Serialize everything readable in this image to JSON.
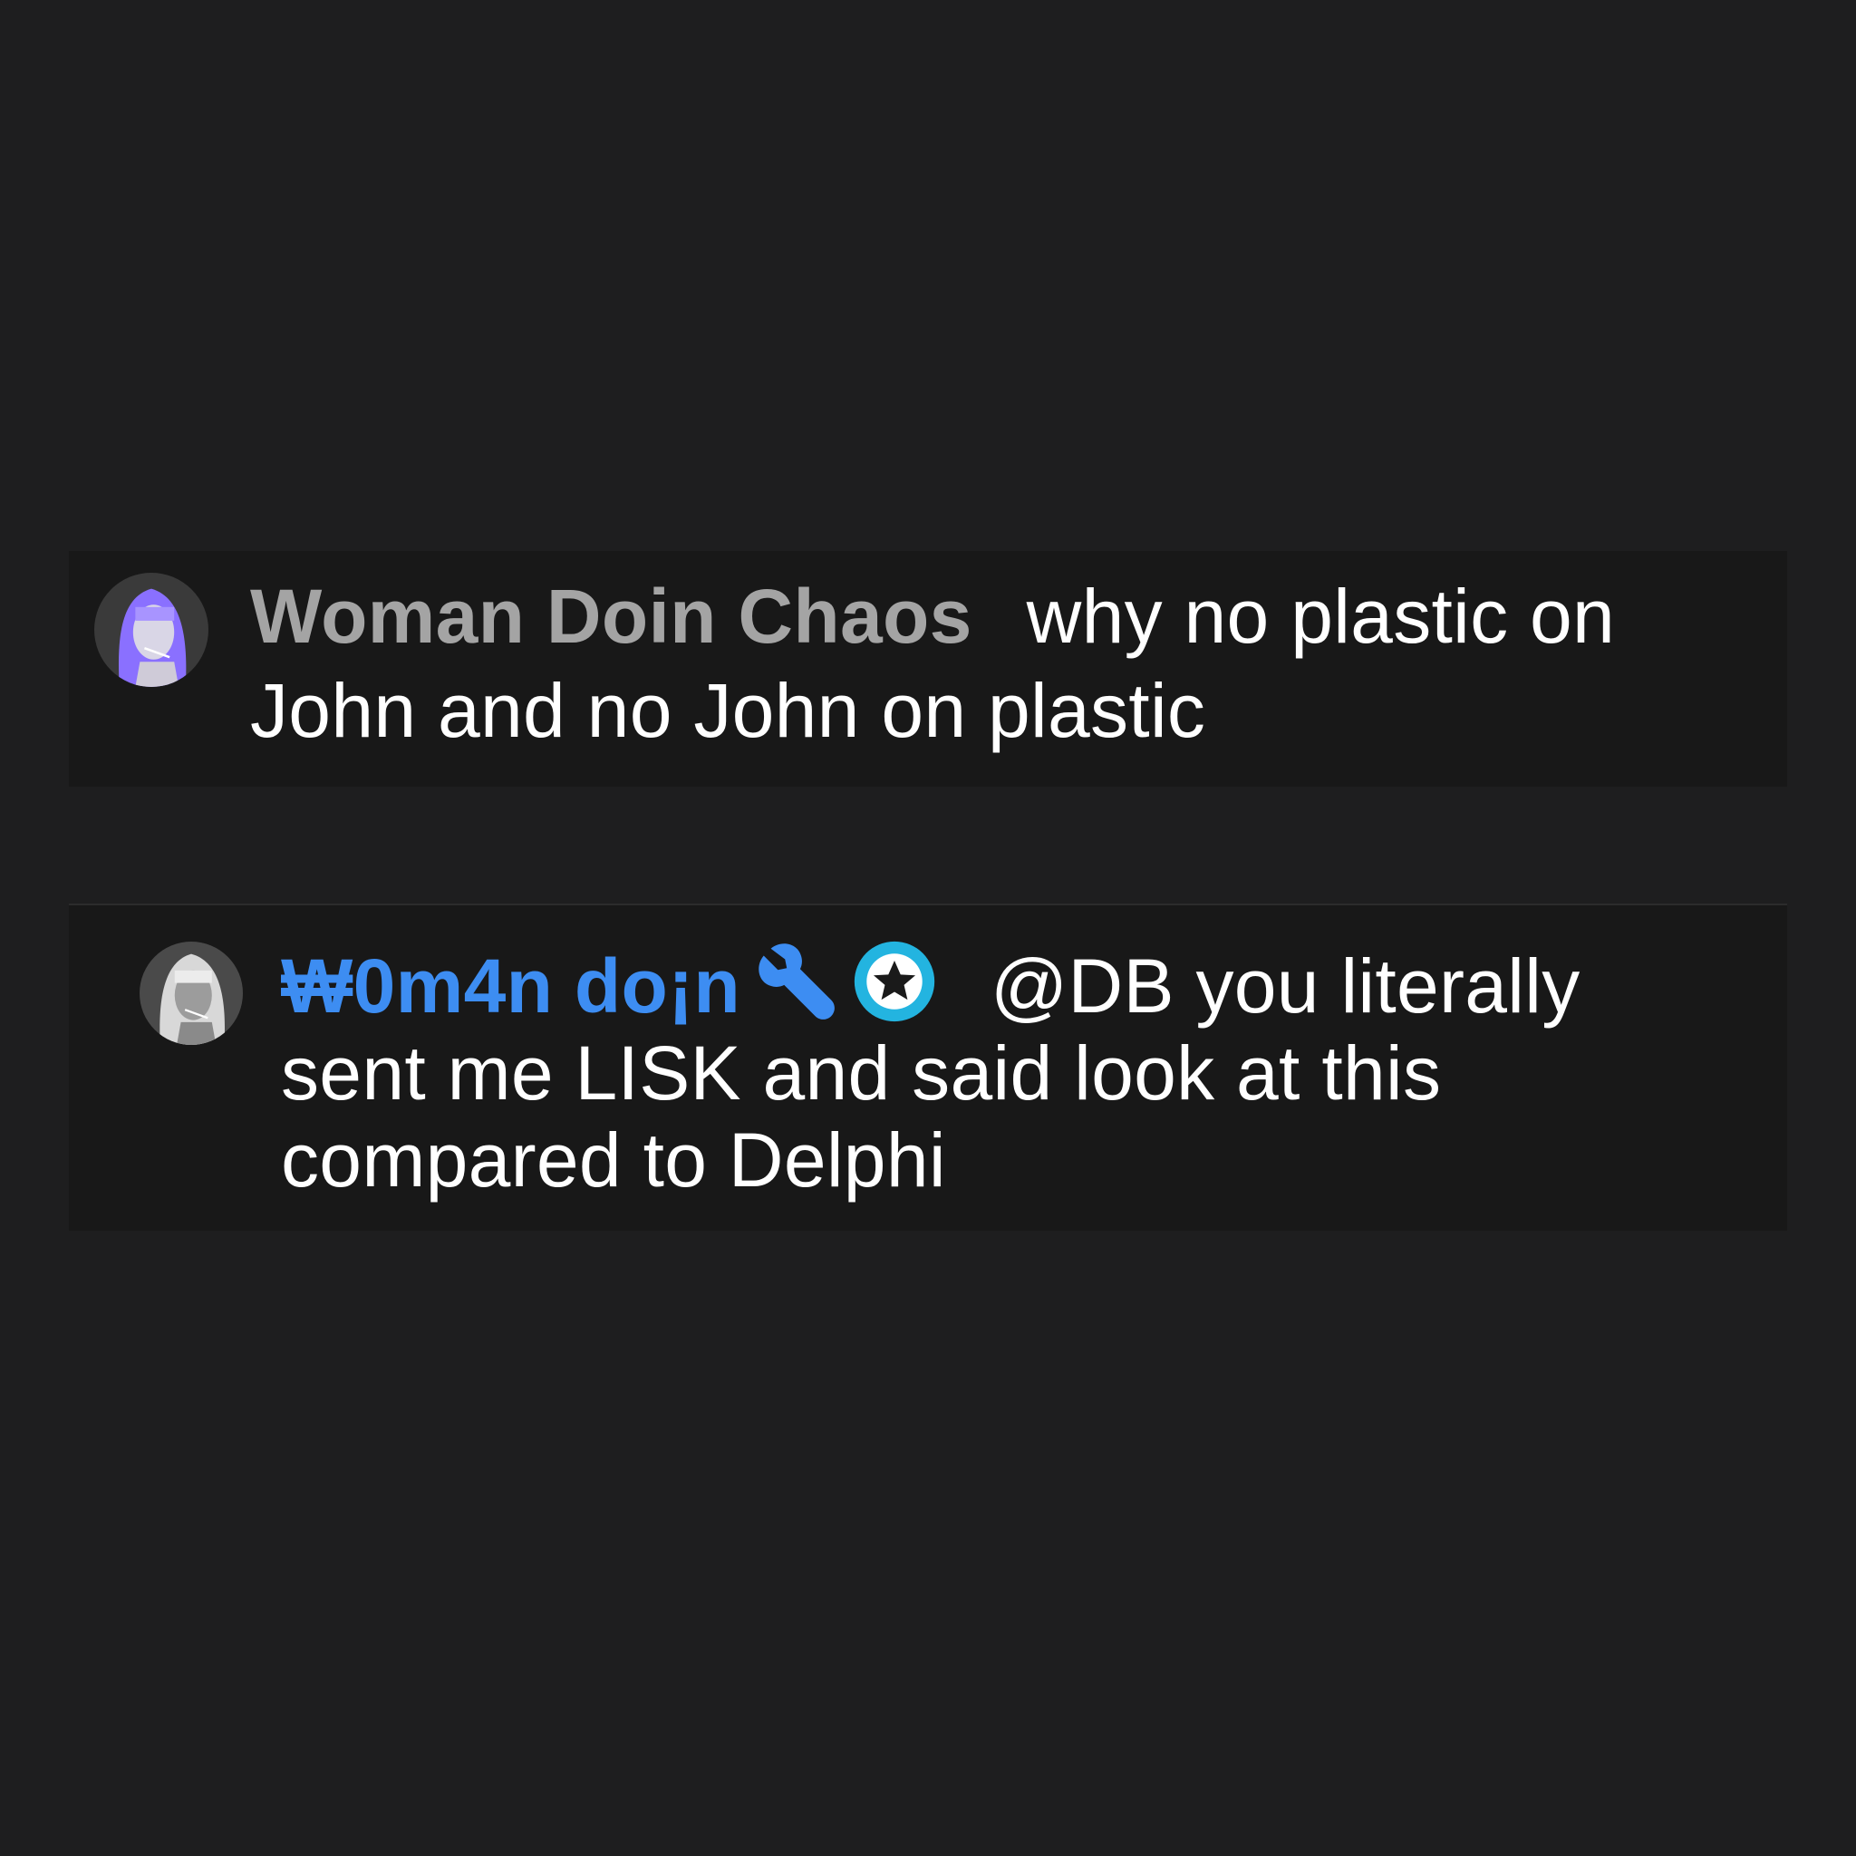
{
  "comments": [
    {
      "author": "Woman Doin Chaos",
      "text": "why no plastic on John and no John on plastic",
      "author_color": "#a4a4a4",
      "avatar_tint": "#8a70ff"
    },
    {
      "author": "₩0m4n do¡n",
      "text": "@DB you literally sent me LISK and said look at this compared to Delphi",
      "author_color": "#3d8df2",
      "badges": [
        "wrench-icon",
        "star-circle-icon"
      ],
      "badge_colors": {
        "wrench": "#3d8df2",
        "star_circle": "#23b4e0"
      }
    }
  ],
  "colors": {
    "page_bg": "#1e1e1f",
    "comment_bg": "#181818",
    "text": "#ffffff"
  }
}
